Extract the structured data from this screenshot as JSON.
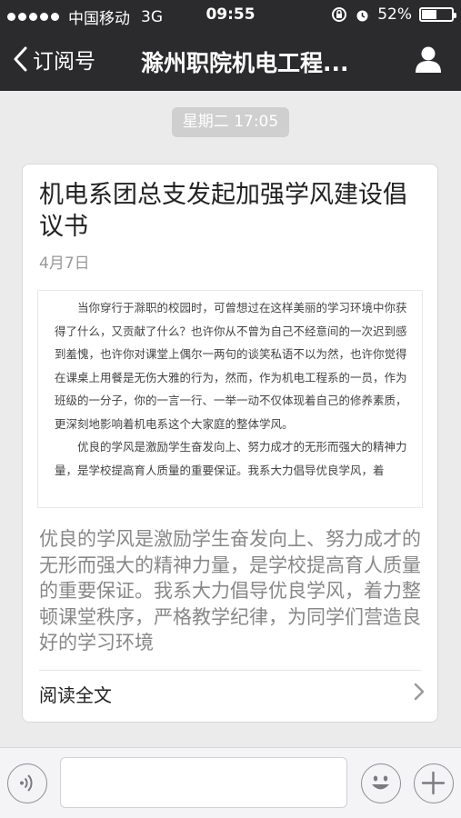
{
  "status_bar": {
    "carrier": "中国移动",
    "network": "3G",
    "time": "09:55",
    "battery_percent": "52%",
    "battery_level": 0.52
  },
  "nav": {
    "back_label": "订阅号",
    "title": "滁州职院机电工程..."
  },
  "timestamp": "星期二 17:05",
  "article": {
    "title": "机电系团总支发起加强学风建设倡议书",
    "date": "4月7日",
    "image_paragraph_1": "当你穿行于滁职的校园时，可曾想过在这样美丽的学习环境中你获得了什么，又贡献了什么？也许你从不曾为自己不经意间的一次迟到感到羞愧，也许你对课堂上偶尔一两句的谈笑私语不以为然，也许你觉得在课桌上用餐是无伤大雅的行为，然而，作为机电工程系的一员，作为班级的一分子，你的一言一行、一举一动不仅体现着自己的修养素质，更深刻地影响着机电系这个大家庭的整体学风。",
    "image_paragraph_2": "优良的学风是激励学生奋发向上、努力成才的无形而强大的精神力量，是学校提高育人质量的重要保证。我系大力倡导优良学风，着",
    "summary": "优良的学风是激励学生奋发向上、努力成才的无形而强大的精神力量，是学校提高育人质量的重要保证。我系大力倡导优良学风，着力整顿课堂秩序，严格教学纪律，为同学们营造良好的学习环境",
    "read_more": "阅读全文"
  },
  "input_bar": {
    "voice_icon": "voice-icon",
    "emoji_icon": "emoji-icon",
    "plus_icon": "plus-icon"
  }
}
